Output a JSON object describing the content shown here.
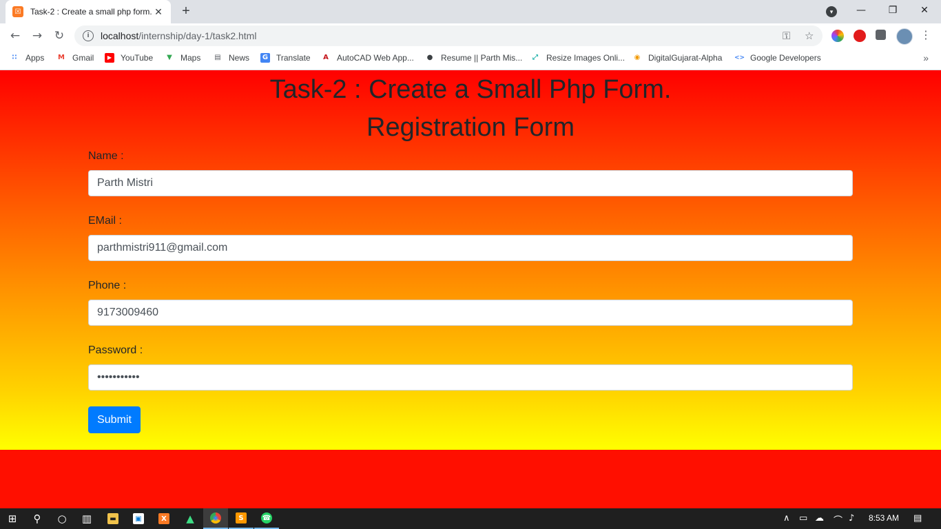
{
  "browser": {
    "tab": {
      "title": "Task-2 : Create a small php form.",
      "favicon_glyph": "☒",
      "close_glyph": "✕"
    },
    "new_tab_glyph": "+",
    "address": {
      "host": "localhost",
      "path": "/internship/day-1/task2.html",
      "info_glyph": "i"
    },
    "nav": {
      "back_glyph": "←",
      "forward_glyph": "→",
      "reload_glyph": "↻"
    },
    "window_controls": {
      "minimize": "—",
      "restore": "❐",
      "close": "✕"
    },
    "omnibox_icons": {
      "key": "⚿",
      "star": "☆"
    },
    "menu_glyph": "⋮",
    "bookmarks": [
      {
        "label": "Apps",
        "icon": "apps-grid-icon",
        "color": "#4285f4",
        "glyph": "∷"
      },
      {
        "label": "Gmail",
        "icon": "gmail-icon",
        "color": "#ea4335",
        "glyph": "M"
      },
      {
        "label": "YouTube",
        "icon": "youtube-icon",
        "color": "#ff0000",
        "glyph": "▶"
      },
      {
        "label": "Maps",
        "icon": "maps-icon",
        "color": "#34a853",
        "glyph": "▼"
      },
      {
        "label": "News",
        "icon": "news-icon",
        "color": "#5f6368",
        "glyph": "▤"
      },
      {
        "label": "Translate",
        "icon": "translate-icon",
        "color": "#4285f4",
        "glyph": "G"
      },
      {
        "label": "AutoCAD Web App...",
        "icon": "autocad-icon",
        "color": "#c4161c",
        "glyph": "A"
      },
      {
        "label": "Resume || Parth Mis...",
        "icon": "globe-icon",
        "color": "#3c4043",
        "glyph": "●"
      },
      {
        "label": "Resize Images Onli...",
        "icon": "resize-icon",
        "color": "#20b2aa",
        "glyph": "⤢"
      },
      {
        "label": "DigitalGujarat-Alpha",
        "icon": "digitalgujarat-icon",
        "color": "#f29900",
        "glyph": "◉"
      },
      {
        "label": "Google Developers",
        "icon": "google-developers-icon",
        "color": "#4285f4",
        "glyph": "<>"
      }
    ],
    "bookmarks_more_glyph": "»"
  },
  "page": {
    "title": "Task-2 : Create a Small Php Form.",
    "subtitle": "Registration Form",
    "fields": {
      "name": {
        "label": "Name :",
        "value": "Parth Mistri"
      },
      "email": {
        "label": "EMail :",
        "value": "parthmistri911@gmail.com"
      },
      "phone": {
        "label": "Phone :",
        "value": "9173009460"
      },
      "password": {
        "label": "Password :",
        "value": "parthmistri"
      }
    },
    "submit_label": "Submit",
    "colors": {
      "gradient_top": "#ff0000",
      "gradient_bottom": "#ffff00",
      "button": "#007bff"
    }
  },
  "taskbar": {
    "items": [
      {
        "name": "start-button",
        "glyph": "⊞"
      },
      {
        "name": "search-button",
        "glyph": "⚲"
      },
      {
        "name": "cortana-button",
        "glyph": "○"
      },
      {
        "name": "task-view-button",
        "glyph": "▥"
      },
      {
        "name": "file-explorer",
        "glyph": "▬"
      },
      {
        "name": "microsoft-store",
        "glyph": "▣"
      },
      {
        "name": "xampp",
        "glyph": "X"
      },
      {
        "name": "android-studio",
        "glyph": "▲"
      },
      {
        "name": "chrome",
        "glyph": "◉"
      },
      {
        "name": "sublime-text",
        "glyph": "S"
      },
      {
        "name": "whatsapp",
        "glyph": "☎"
      }
    ],
    "tray": {
      "chevron_glyph": "∧",
      "battery_glyph": "▭",
      "cloud_glyph": "☁",
      "wifi_glyph": "⌒",
      "volume_glyph": "♪",
      "notifications_glyph": "▤"
    },
    "time": "8:53 AM"
  }
}
